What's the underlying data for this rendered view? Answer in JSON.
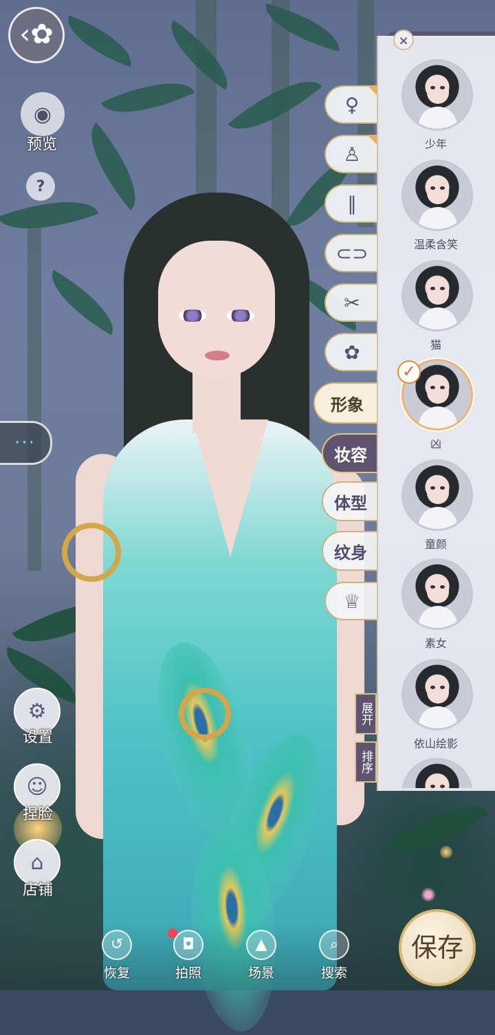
{
  "left_panel": {
    "preview_label": "预览",
    "help_glyph": "?",
    "chat_glyph": "···",
    "settings_label": "设置",
    "face_label": "捏脸",
    "shop_label": "店铺"
  },
  "category_tabs": {
    "icons": [
      "hairstyle-icon",
      "outfit-icon",
      "socks-icon",
      "shoes-icon",
      "accessory-icon",
      "hairpin-icon",
      "custom-outfit-icon"
    ],
    "appearance_label": "形象",
    "makeup_label": "妆容",
    "body_label": "体型",
    "tattoo_label": "纹身"
  },
  "preset_panel": {
    "close_glyph": "×",
    "presets": [
      {
        "name": "少年"
      },
      {
        "name": "温柔含笑"
      },
      {
        "name": "猫"
      },
      {
        "name": "凶"
      },
      {
        "name": "童颜"
      },
      {
        "name": "素女"
      },
      {
        "name": "依山绘影"
      }
    ],
    "selected_index": 3,
    "check_glyph": "✓",
    "expand_label": "展开",
    "sort_label": "排序"
  },
  "bottom_toolbar": {
    "restore_label": "恢复",
    "photo_label": "拍照",
    "scene_label": "场景",
    "search_label": "搜索",
    "save_label": "保存"
  },
  "colors": {
    "accent_gold": "#d8b772",
    "tab_dark": "#5e5470",
    "panel_bg": "#ecedf3",
    "record_dot": "#ff3d5a"
  }
}
